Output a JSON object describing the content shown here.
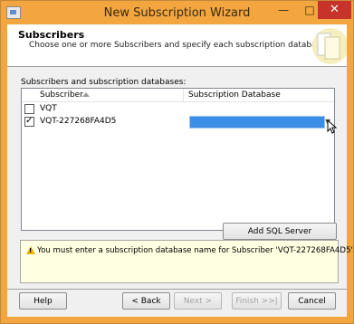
{
  "window": {
    "title": "New Subscription Wizard",
    "minimize": "—",
    "maximize": "□",
    "close": "✕"
  },
  "header": {
    "title": "Subscribers",
    "subtitle": "Choose one or more Subscribers and specify each subscription database."
  },
  "grid": {
    "label": "Subscribers and subscription databases:",
    "columns": {
      "subscriber": "Subscriber",
      "database": "Subscription Database"
    },
    "rows": [
      {
        "name": "VQT",
        "checked": false,
        "database": ""
      },
      {
        "name": "VQT-227268FA4D5",
        "checked": true,
        "database": ""
      }
    ]
  },
  "buttons": {
    "add_subscriber": "Add SQL Server Subscriber...",
    "help": "Help",
    "back": "< Back",
    "next": "Next >",
    "finish": "Finish >>|",
    "cancel": "Cancel"
  },
  "message": "You must enter a subscription database name for Subscriber 'VQT-227268FA4D5'.",
  "colors": {
    "titlebar": "#f3a53f",
    "close": "#c7322b",
    "selection": "#3a8ee6",
    "message_bg": "#ffffe1"
  }
}
